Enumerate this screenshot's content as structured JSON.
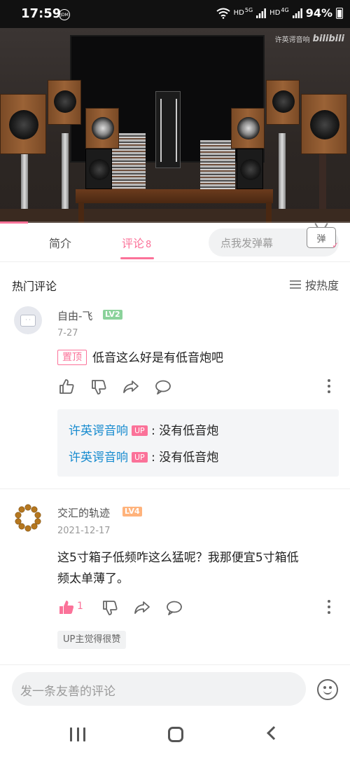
{
  "status_bar": {
    "time": "17:59",
    "carrier_badge": "JDM",
    "network_1": "HD",
    "network_1_sub": "5G",
    "network_2": "HD",
    "network_2_sub": "4G",
    "battery": "94%"
  },
  "video": {
    "watermark_text": "许英谔音响",
    "watermark_logo": "bilibili",
    "progress_fraction": 0.08
  },
  "tabs": {
    "intro": "简介",
    "comments": "评论",
    "comments_count": "8",
    "danmaku_placeholder": "点我发弹幕",
    "danmaku_button": "弹"
  },
  "hot": {
    "title": "热门评论",
    "sort_label": "按热度"
  },
  "comments": [
    {
      "username": "自由-飞",
      "level": "LV2",
      "date": "7-27",
      "pin_label": "置顶",
      "text": "低音这么好是有低音炮吧",
      "replies": [
        {
          "name": "许英谔音响",
          "badge": "UP",
          "text": ": 没有低音炮"
        },
        {
          "name": "许英谔音响",
          "badge": "UP",
          "text": ": 没有低音炮"
        }
      ]
    },
    {
      "username": "交汇的轨迹",
      "level": "LV4",
      "date": "2021-12-17",
      "text_line1": "这5寸箱子低频咋这么猛呢？我那便宜5寸箱低",
      "text_line2": "频太单薄了。",
      "like_count": "1",
      "up_liked_label": "UP主觉得很赞"
    }
  ],
  "bottom": {
    "comment_placeholder": "发一条友善的评论"
  },
  "colors": {
    "accent": "#fb7299",
    "reply_name": "#178bcf"
  }
}
